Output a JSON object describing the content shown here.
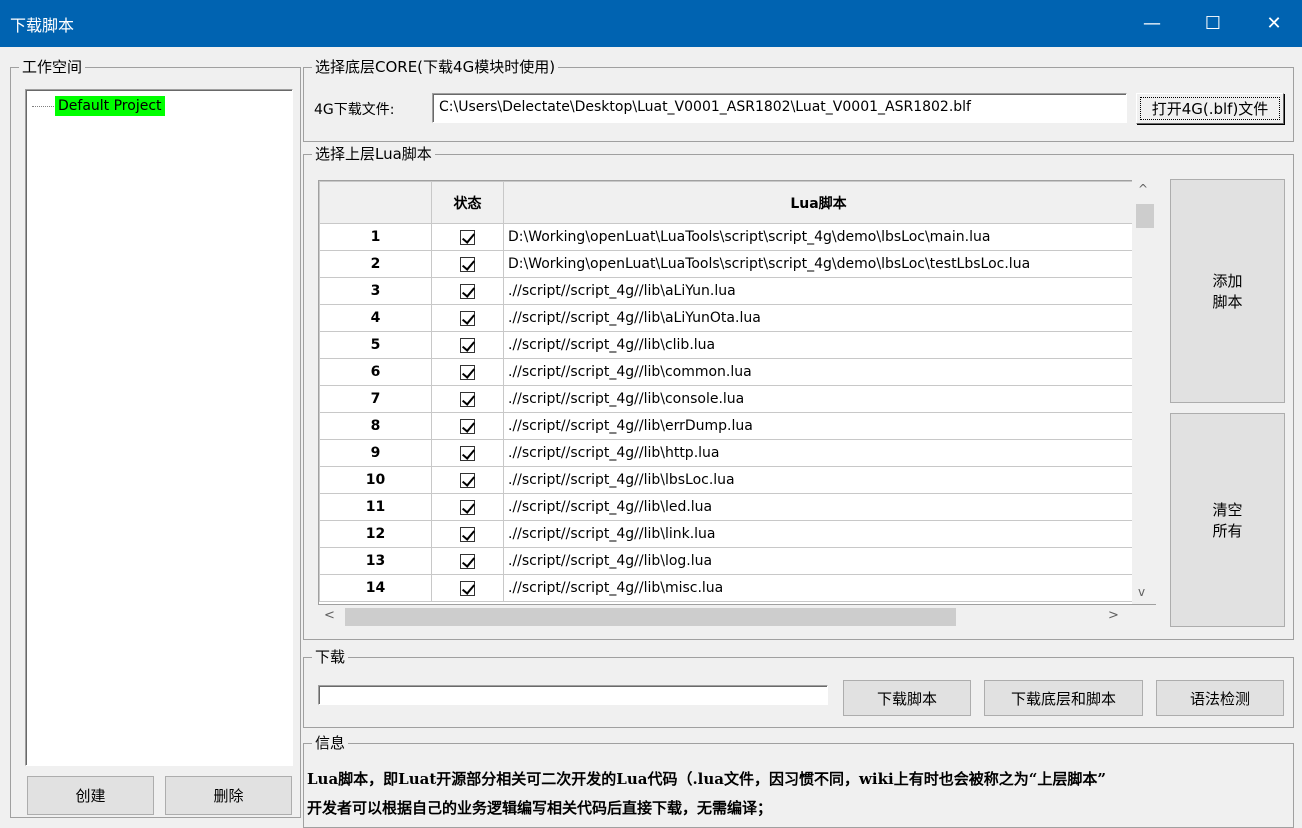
{
  "window": {
    "title": "下载脚本",
    "minimize_glyph": "—",
    "maximize_glyph": "☐",
    "close_glyph": "✕"
  },
  "workspace": {
    "group_label": "工作空间",
    "project_name": "Default Project",
    "create_label": "创建",
    "delete_label": "删除"
  },
  "core": {
    "group_label": "选择底层CORE(下载4G模块时使用)",
    "file_label": "4G下载文件:",
    "file_path": "C:\\Users\\Delectate\\Desktop\\Luat_V0001_ASR1802\\Luat_V0001_ASR1802.blf",
    "open_label": "打开4G(.blf)文件"
  },
  "scripts": {
    "group_label": "选择上层Lua脚本",
    "col_status": "状态",
    "col_script": "Lua脚本",
    "add_label_1": "添加",
    "add_label_2": "脚本",
    "clear_label_1": "清空",
    "clear_label_2": "所有",
    "rows": [
      {
        "n": "1",
        "path": "D:\\Working\\openLuat\\LuaTools\\script\\script_4g\\demo\\lbsLoc\\main.lua"
      },
      {
        "n": "2",
        "path": "D:\\Working\\openLuat\\LuaTools\\script\\script_4g\\demo\\lbsLoc\\testLbsLoc.lua"
      },
      {
        "n": "3",
        "path": ".//script//script_4g//lib\\aLiYun.lua"
      },
      {
        "n": "4",
        "path": ".//script//script_4g//lib\\aLiYunOta.lua"
      },
      {
        "n": "5",
        "path": ".//script//script_4g//lib\\clib.lua"
      },
      {
        "n": "6",
        "path": ".//script//script_4g//lib\\common.lua"
      },
      {
        "n": "7",
        "path": ".//script//script_4g//lib\\console.lua"
      },
      {
        "n": "8",
        "path": ".//script//script_4g//lib\\errDump.lua"
      },
      {
        "n": "9",
        "path": ".//script//script_4g//lib\\http.lua"
      },
      {
        "n": "10",
        "path": ".//script//script_4g//lib\\lbsLoc.lua"
      },
      {
        "n": "11",
        "path": ".//script//script_4g//lib\\led.lua"
      },
      {
        "n": "12",
        "path": ".//script//script_4g//lib\\link.lua"
      },
      {
        "n": "13",
        "path": ".//script//script_4g//lib\\log.lua"
      },
      {
        "n": "14",
        "path": ".//script//script_4g//lib\\misc.lua"
      }
    ]
  },
  "download": {
    "group_label": "下载",
    "download_script_label": "下载脚本",
    "download_all_label": "下载底层和脚本",
    "syntax_check_label": "语法检测",
    "progress": 0
  },
  "info": {
    "group_label": "信息",
    "line1": "Lua脚本，即Luat开源部分相关可二次开发的Lua代码（.lua文件，因习惯不同，wiki上有时也会被称之为“上层脚本”",
    "line2": "开发者可以根据自己的业务逻辑编写相关代码后直接下载，无需编译；"
  }
}
